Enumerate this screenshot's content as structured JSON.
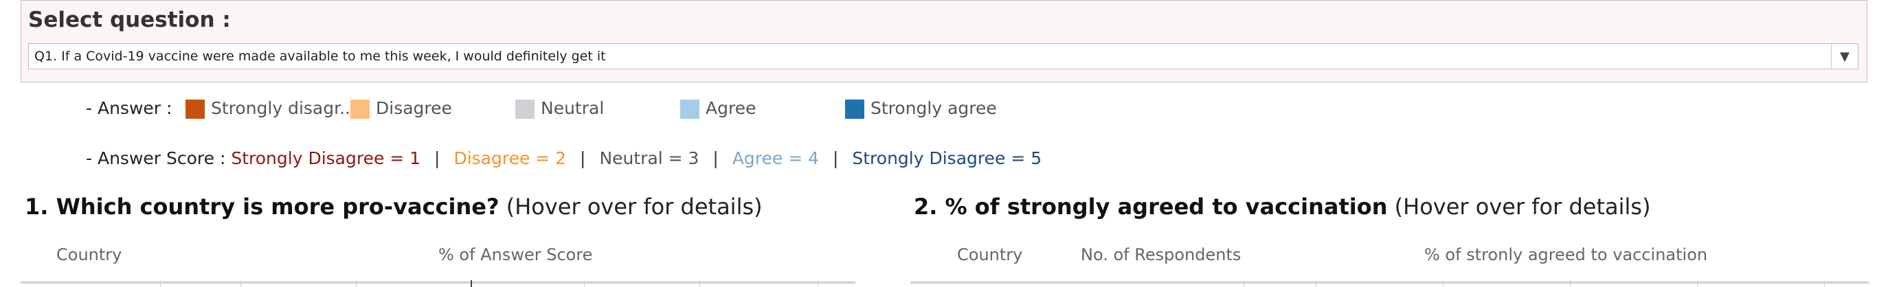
{
  "filter": {
    "title": "Select question :",
    "selected": "Q1. If a Covid-19 vaccine were made available to me this week, I would definitely get it",
    "arrow": "▼"
  },
  "legend": {
    "caption": "- Answer :",
    "items": [
      {
        "label": "Strongly disagr..",
        "color": "#c8520d"
      },
      {
        "label": "Disagree",
        "color": "#fdbd7c"
      },
      {
        "label": "Neutral",
        "color": "#cdd1d6"
      },
      {
        "label": "Agree",
        "color": "#a5cde9"
      },
      {
        "label": "Strongly agree",
        "color": "#1f72aa"
      }
    ]
  },
  "score": {
    "caption": "- Answer Score :",
    "items": [
      {
        "text": "Strongly Disagree = 1",
        "color": "#8b1a10"
      },
      {
        "text": "Disagree = 2",
        "color": "#f0952f"
      },
      {
        "text": "Neutral = 3",
        "color": "#555555"
      },
      {
        "text": "Agree = 4",
        "color": "#79a8cc"
      },
      {
        "text": "Strongly Disagree = 5",
        "color": "#1f4a7a"
      }
    ],
    "separator": "|"
  },
  "section1": {
    "title": "1. Which country is more pro-vaccine?",
    "hover": "(Hover over for details)",
    "col_country": "Country",
    "col_score": "% of Answer Score"
  },
  "section2": {
    "title": "2. % of strongly agreed to vaccination",
    "hover": "(Hover over for details)",
    "col_country": "Country",
    "col_respondents": "No. of Respondents",
    "col_pct": "% of stronly agreed to vaccination"
  }
}
